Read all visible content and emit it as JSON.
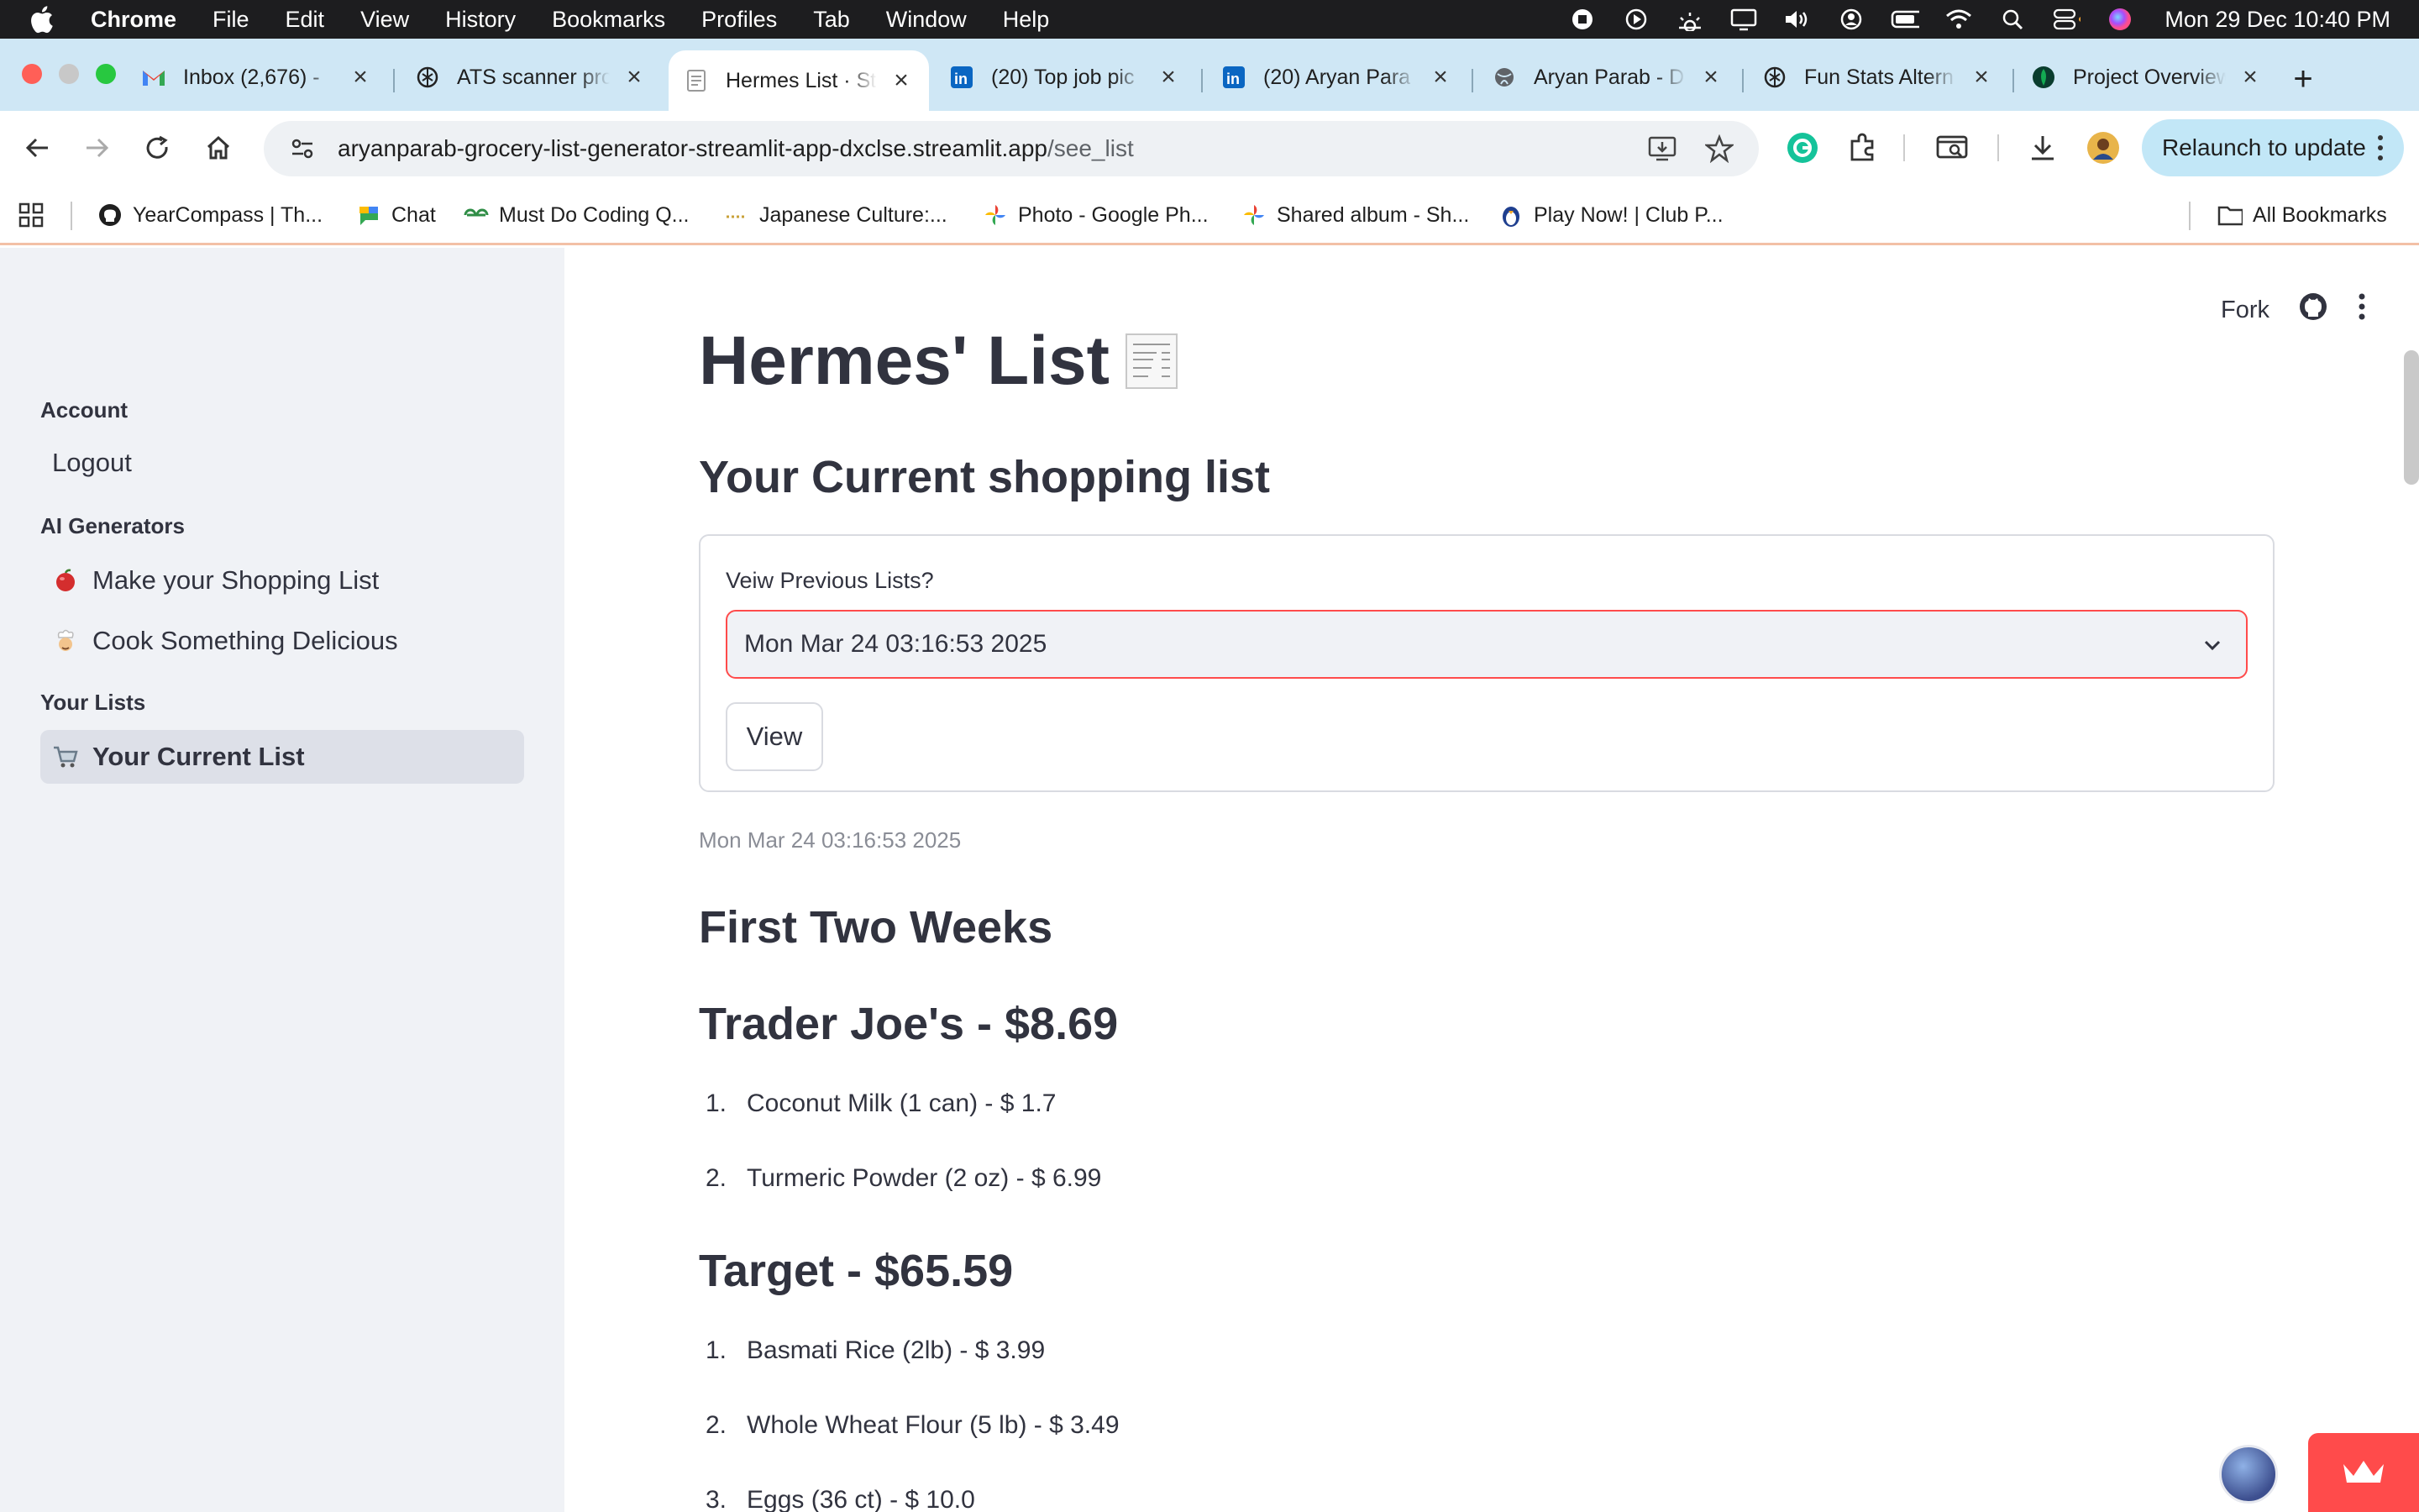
{
  "menubar": {
    "app": "Chrome",
    "menus": [
      "File",
      "Edit",
      "View",
      "History",
      "Bookmarks",
      "Profiles",
      "Tab",
      "Window",
      "Help"
    ],
    "clock": "Mon 29 Dec  10:40 PM"
  },
  "tabs": [
    {
      "title": "Inbox (2,676) - ",
      "icon": "gmail-icon"
    },
    {
      "title": "ATS scanner pro",
      "icon": "chatgpt-icon"
    },
    {
      "title": "Hermes List · St",
      "icon": "page-icon",
      "active": true
    },
    {
      "title": "(20) Top job pic",
      "icon": "linkedin-icon"
    },
    {
      "title": "(20) Aryan Para",
      "icon": "linkedin-icon"
    },
    {
      "title": "Aryan Parab - D",
      "icon": "globe-icon"
    },
    {
      "title": "Fun Stats Altern",
      "icon": "chatgpt-icon"
    },
    {
      "title": "Project Overview",
      "icon": "mongodb-icon"
    }
  ],
  "toolbar": {
    "url_host": "aryanparab-grocery-list-generator-streamlit-app-dxclse.streamlit.app",
    "url_path": "/see_list",
    "relaunch_label": "Relaunch to update"
  },
  "bookmarks": {
    "items": [
      {
        "label": "YearCompass | Th...",
        "icon": "github-icon"
      },
      {
        "label": "Chat",
        "icon": "chat-icon"
      },
      {
        "label": "Must Do Coding Q...",
        "icon": "gfg-icon"
      },
      {
        "label": "Japanese Culture:...",
        "icon": "sparkle-icon"
      },
      {
        "label": "Photo - Google Ph...",
        "icon": "google-photos-icon"
      },
      {
        "label": "Shared album - Sh...",
        "icon": "google-photos-icon"
      },
      {
        "label": "Play Now! | Club P...",
        "icon": "penguin-icon"
      }
    ],
    "all_label": "All Bookmarks"
  },
  "sidebar": {
    "sections": [
      {
        "heading": "Account",
        "items": [
          {
            "label": "Logout",
            "emoji": ""
          }
        ]
      },
      {
        "heading": "AI Generators",
        "items": [
          {
            "label": "Make your Shopping List",
            "emoji": "🍎"
          },
          {
            "label": "Cook Something Delicious",
            "emoji": "👨‍🍳"
          }
        ]
      },
      {
        "heading": "Your Lists",
        "items": [
          {
            "label": "Your Current List",
            "emoji": "🛒",
            "active": true
          }
        ]
      }
    ]
  },
  "header": {
    "fork_label": "Fork"
  },
  "main": {
    "title": "Hermes' List",
    "subtitle": "Your Current shopping list",
    "select_label": "Veiw Previous Lists?",
    "select_value": "Mon Mar 24 03:16:53 2025",
    "view_button": "View",
    "caption": "Mon Mar 24 03:16:53 2025",
    "period": "First Two Weeks",
    "stores": [
      {
        "name": "Trader Joe's - $8.69",
        "items": [
          "Coconut Milk (1 can) - $ 1.7",
          "Turmeric Powder (2 oz) - $ 6.99"
        ]
      },
      {
        "name": "Target - $65.59",
        "items": [
          "Basmati Rice (2lb) - $ 3.99",
          "Whole Wheat Flour (5 lb) - $ 3.49",
          "Eggs (36 ct) - $ 10.0"
        ]
      }
    ]
  },
  "colors": {
    "accent": "#ff4b4b",
    "sidebar_bg": "#f0f2f6",
    "tab_strip": "#cfe7f5",
    "text": "#31333f"
  }
}
